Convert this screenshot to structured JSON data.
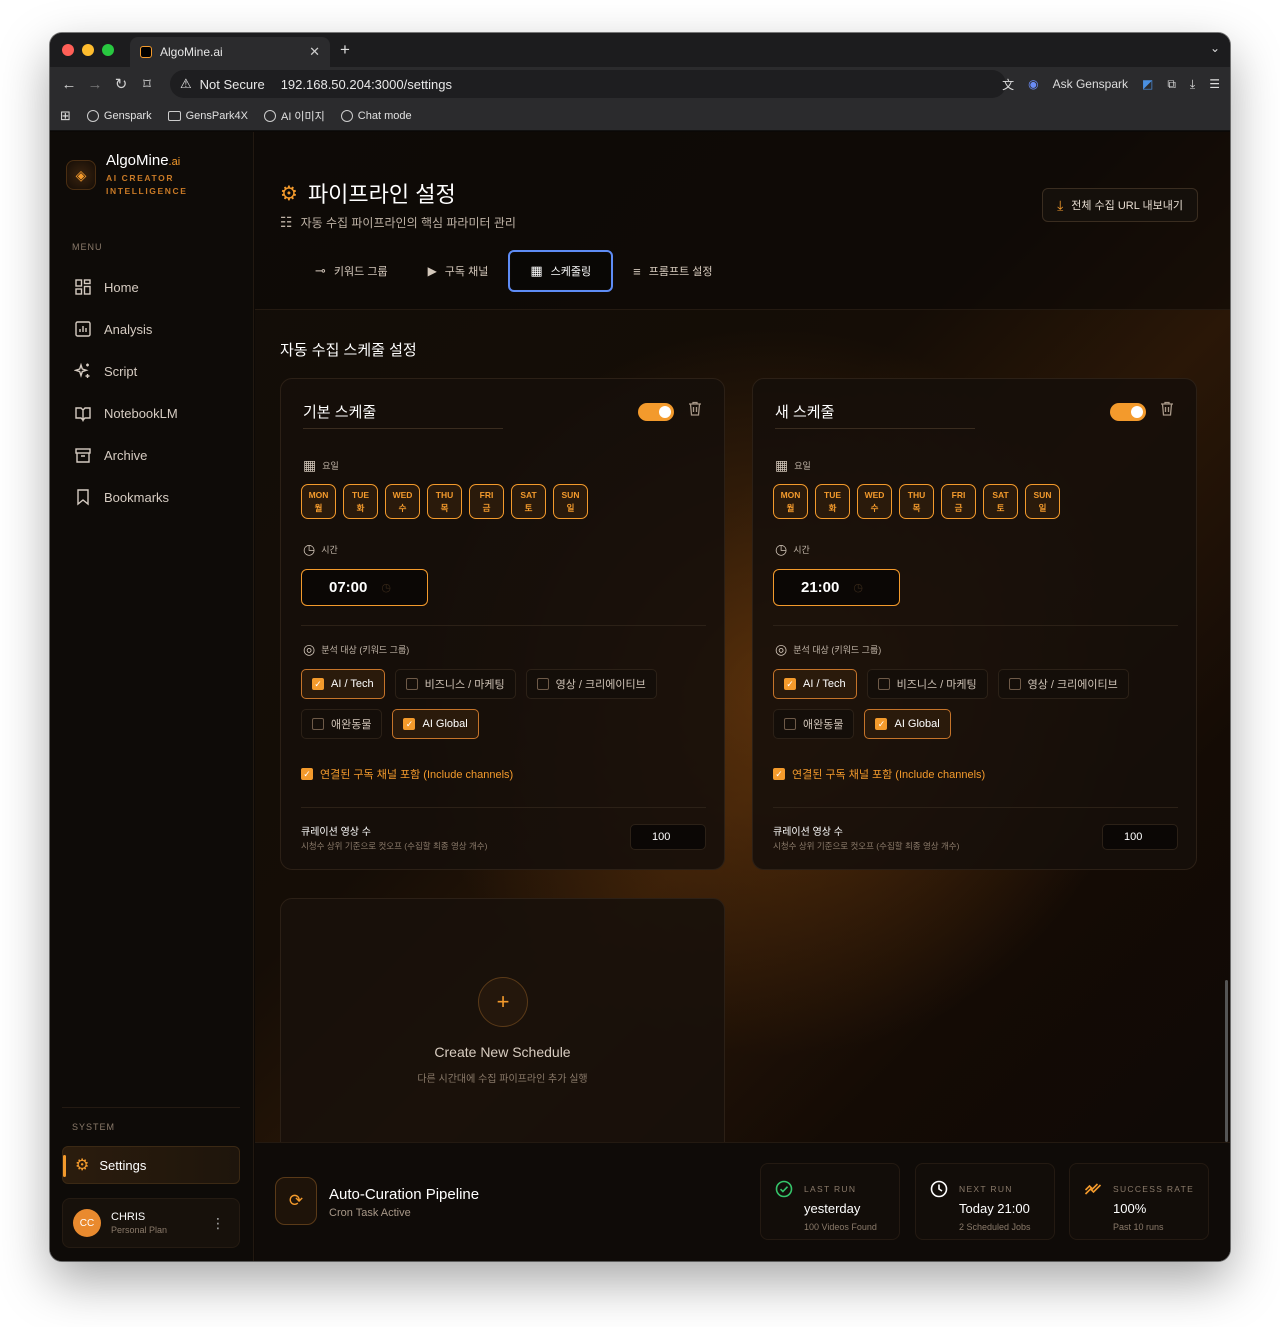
{
  "browser": {
    "tab_title": "AlgoMine.ai",
    "security": "Not Secure",
    "url": "192.168.50.204:3000/settings",
    "ask_label": "Ask Genspark",
    "bookmarks": [
      "Genspark",
      "GensPark4X",
      "AI 이미지",
      "Chat mode"
    ]
  },
  "brand": {
    "name": "AlgoMine",
    "suffix": ".ai",
    "sub1": "AI CREATOR",
    "sub2": "INTELLIGENCE"
  },
  "sidebar": {
    "menu_label": "MENU",
    "items": [
      {
        "label": "Home",
        "icon": "grid-icon"
      },
      {
        "label": "Analysis",
        "icon": "chart-icon"
      },
      {
        "label": "Script",
        "icon": "sparkle-icon"
      },
      {
        "label": "NotebookLM",
        "icon": "book-icon"
      },
      {
        "label": "Archive",
        "icon": "archive-icon"
      },
      {
        "label": "Bookmarks",
        "icon": "bookmark-icon"
      }
    ],
    "system_label": "SYSTEM",
    "settings_label": "Settings",
    "user": {
      "initials": "CC",
      "name": "CHRIS",
      "plan": "Personal Plan"
    }
  },
  "header": {
    "title": "파이프라인 설정",
    "subtitle": "자동 수집 파이프라인의 핵심 파라미터 관리",
    "export_label": "전체 수집 URL 내보내기",
    "tabs": [
      "키워드 그룹",
      "구독 채널",
      "스케줄링",
      "프롬프트 설정"
    ],
    "active_tab": "스케줄링"
  },
  "section_title": "자동 수집 스케줄 설정",
  "labels": {
    "days": "요일",
    "time": "시간",
    "target": "분석 대상 (키워드 그룹)",
    "include": "연결된 구독 채널 포함 (Include channels)",
    "curation": "큐레이션 영상 수",
    "curation_sub": "시청수 상위 기준으로 컷오프 (수집할 최종 영상 개수)"
  },
  "days": [
    {
      "en": "MON",
      "ko": "월"
    },
    {
      "en": "TUE",
      "ko": "화"
    },
    {
      "en": "WED",
      "ko": "수"
    },
    {
      "en": "THU",
      "ko": "목"
    },
    {
      "en": "FRI",
      "ko": "금"
    },
    {
      "en": "SAT",
      "ko": "토"
    },
    {
      "en": "SUN",
      "ko": "일"
    }
  ],
  "groups": [
    "AI / Tech",
    "비즈니스 / 마케팅",
    "영상 / 크리에이티브",
    "애완동물",
    "AI Global"
  ],
  "schedules": [
    {
      "name": "기본 스케줄",
      "enabled": true,
      "time": "07:00",
      "selected_groups": [
        "AI / Tech",
        "AI Global"
      ],
      "include_channels": true,
      "curation_count": "100"
    },
    {
      "name": "새 스케줄",
      "enabled": true,
      "time": "21:00",
      "selected_groups": [
        "AI / Tech",
        "AI Global"
      ],
      "include_channels": true,
      "curation_count": "100"
    }
  ],
  "new_schedule": {
    "title": "Create New Schedule",
    "subtitle": "다른 시간대에 수집 파이프라인 추가 실행"
  },
  "footer": {
    "title": "Auto-Curation Pipeline",
    "subtitle": "Cron Task Active",
    "stats": [
      {
        "label": "LAST RUN",
        "value": "yesterday",
        "sub": "100 Videos Found",
        "icon": "check-circle-icon"
      },
      {
        "label": "NEXT RUN",
        "value": "Today 21:00",
        "sub": "2 Scheduled Jobs",
        "icon": "clock-icon"
      },
      {
        "label": "SUCCESS RATE",
        "value": "100%",
        "sub": "Past 10 runs",
        "icon": "trend-icon"
      }
    ]
  },
  "colors": {
    "accent": "#f39a2c",
    "active_tab_border": "#5e8cf5",
    "success": "#35c46a"
  }
}
